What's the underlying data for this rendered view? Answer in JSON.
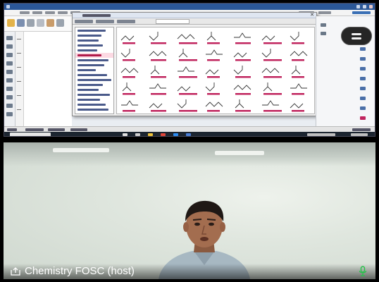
{
  "video_panel": {
    "participant_name": "Chemistry FOSC (host)"
  },
  "icons": {
    "share_screen": "share-screen-icon",
    "view_toggle": "view-toggle-icon",
    "microphone": "microphone-icon",
    "close": "close-icon"
  },
  "colors": {
    "window_titlebar": "#2b5797",
    "selected_category": "#fcd9e3",
    "molecule_label": "#c0245e",
    "mic_active": "#26c24a",
    "overlay_button": "#262626"
  }
}
